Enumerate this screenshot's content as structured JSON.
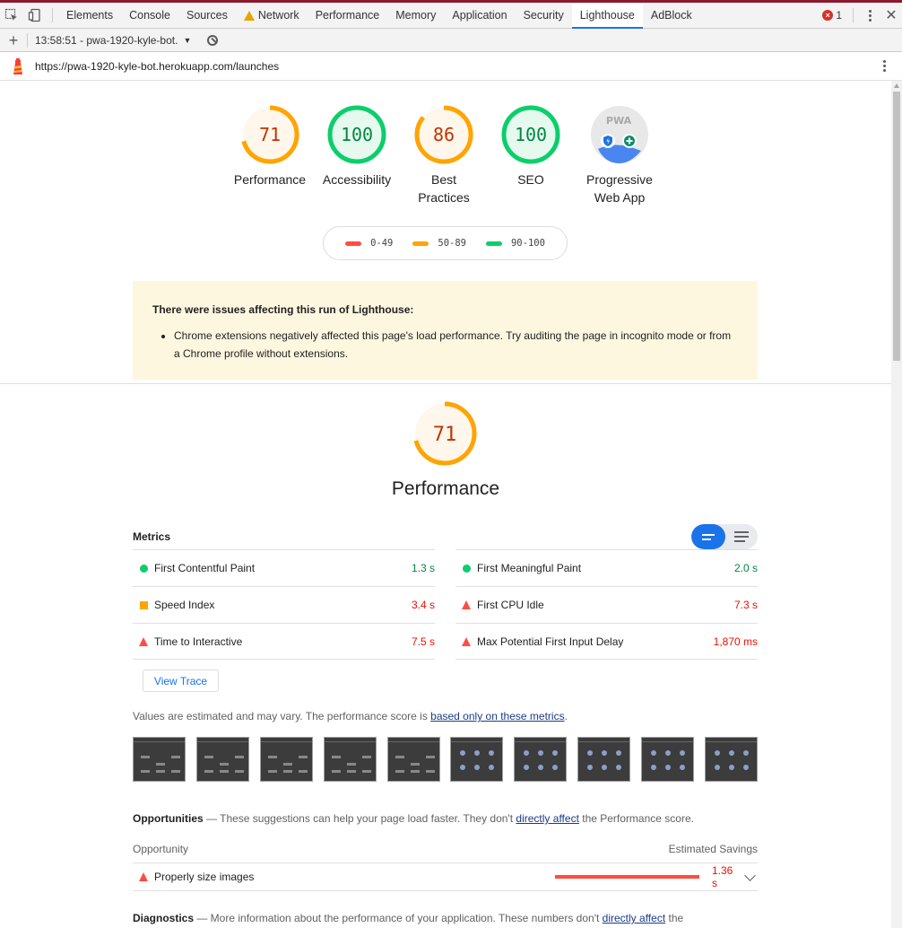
{
  "devtools": {
    "tabs": [
      "Elements",
      "Console",
      "Sources",
      "Network",
      "Performance",
      "Memory",
      "Application",
      "Security",
      "Lighthouse",
      "AdBlock"
    ],
    "active_tab": "Lighthouse",
    "error_count": "1"
  },
  "toolbar": {
    "report_label": "13:58:51 - pwa-1920-kyle-bot."
  },
  "urlbar": {
    "url": "https://pwa-1920-kyle-bot.herokuapp.com/launches"
  },
  "gauges": [
    {
      "score": "71",
      "label": "Performance",
      "status": "average"
    },
    {
      "score": "100",
      "label": "Accessibility",
      "status": "pass"
    },
    {
      "score": "86",
      "label": "Best Practices",
      "status": "average"
    },
    {
      "score": "100",
      "label": "SEO",
      "status": "pass"
    },
    {
      "score": "",
      "label": "Progressive Web App",
      "badge_text": "PWA"
    }
  ],
  "legend": [
    {
      "range": "0-49",
      "color": "#ff4e42"
    },
    {
      "range": "50-89",
      "color": "#ffa400"
    },
    {
      "range": "90-100",
      "color": "#0cce6b"
    }
  ],
  "warning": {
    "title": "There were issues affecting this run of Lighthouse:",
    "items": [
      "Chrome extensions negatively affected this page's load performance. Try auditing the page in incognito mode or from a Chrome profile without extensions."
    ]
  },
  "performance": {
    "score": "71",
    "score_fraction": 0.71,
    "title": "Performance",
    "metrics_heading": "Metrics",
    "metrics_left": [
      {
        "name": "First Contentful Paint",
        "value": "1.3 s",
        "status": "pass"
      },
      {
        "name": "Speed Index",
        "value": "3.4 s",
        "status": "average"
      },
      {
        "name": "Time to Interactive",
        "value": "7.5 s",
        "status": "fail"
      }
    ],
    "metrics_right": [
      {
        "name": "First Meaningful Paint",
        "value": "2.0 s",
        "status": "pass"
      },
      {
        "name": "First CPU Idle",
        "value": "7.3 s",
        "status": "fail"
      },
      {
        "name": "Max Potential First Input Delay",
        "value": "1,870 ms",
        "status": "fail"
      }
    ],
    "view_trace_label": "View Trace",
    "note_prefix": "Values are estimated and may vary. The performance score is ",
    "note_link": "based only on these metrics",
    "note_suffix": "."
  },
  "opportunities": {
    "heading": "Opportunities",
    "desc_prefix": " — These suggestions can help your page load faster. They don't ",
    "desc_link": "directly affect",
    "desc_suffix": " the Performance score.",
    "col_left": "Opportunity",
    "col_right": "Estimated Savings",
    "items": [
      {
        "name": "Properly size images",
        "savings": "1.36 s"
      }
    ]
  },
  "diagnostics": {
    "heading": "Diagnostics",
    "desc_prefix": " — More information about the performance of your application. These numbers don't ",
    "desc_link": "directly affect",
    "desc_suffix": " the"
  }
}
